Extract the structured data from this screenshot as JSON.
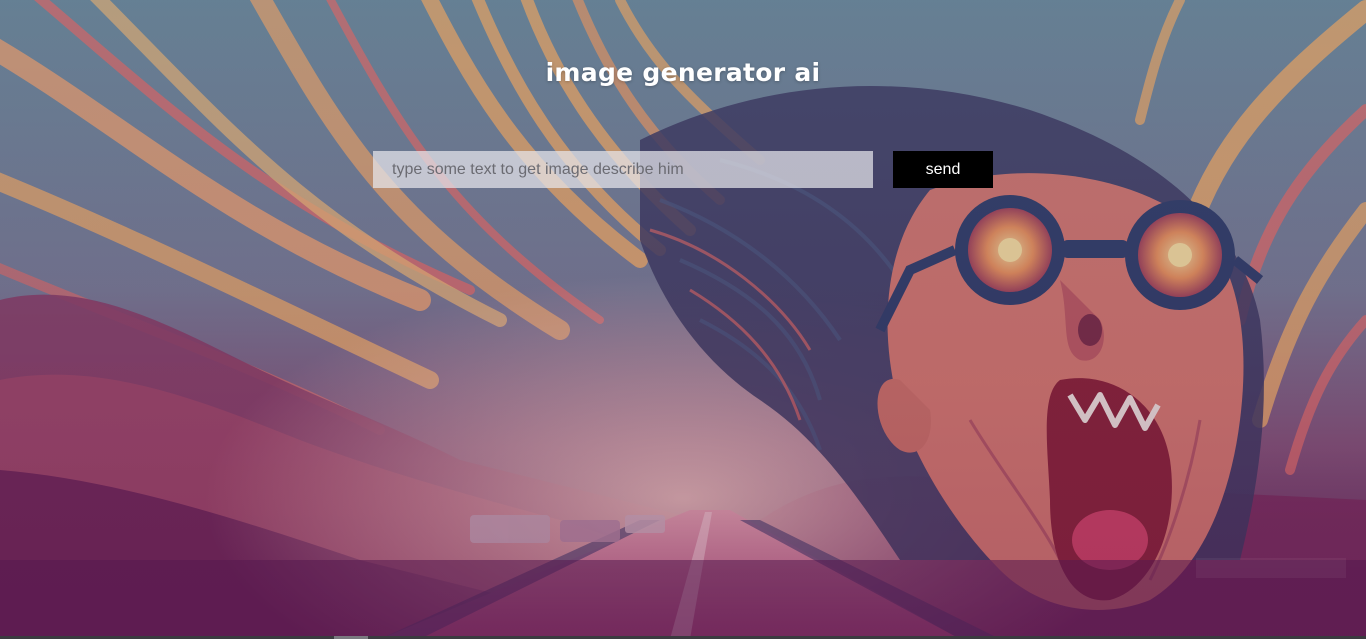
{
  "header": {
    "title": "image generator ai"
  },
  "prompt": {
    "value": "",
    "placeholder": "type some text to get image describe him"
  },
  "actions": {
    "send_label": "send"
  },
  "background": {
    "icon": "psychedelic-illustration",
    "colors": {
      "sky": "#6f8fa0",
      "flame": "#f4b06a",
      "magenta": "#8a2d63",
      "deep": "#4e1a4c",
      "face": "#d9776b"
    }
  },
  "colors": {
    "button_bg": "#000000",
    "button_text": "#ffffff",
    "title_text": "#ffffff"
  }
}
